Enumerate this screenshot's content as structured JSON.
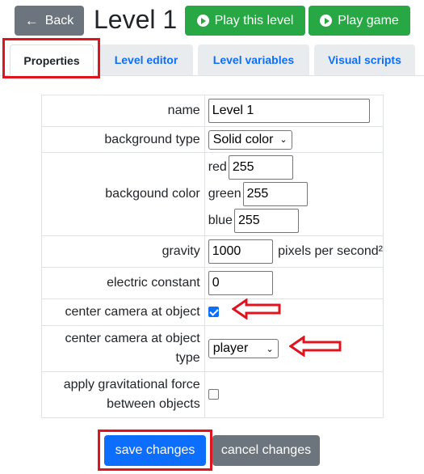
{
  "header": {
    "back_label": "Back",
    "back_icon": "arrow-left-icon",
    "title": "Level 1",
    "play_level_label": "Play this level",
    "play_game_label": "Play game",
    "play_icon": "play-circle-icon"
  },
  "tabs": [
    {
      "label": "Properties",
      "active": true
    },
    {
      "label": "Level editor",
      "active": false
    },
    {
      "label": "Level variables",
      "active": false
    },
    {
      "label": "Visual scripts",
      "active": false
    }
  ],
  "form": {
    "name": {
      "label": "name",
      "value": "Level 1"
    },
    "background_type": {
      "label": "background type",
      "value": "Solid color"
    },
    "background_color": {
      "label": "backgound color",
      "red_label": "red",
      "red_value": "255",
      "green_label": "green",
      "green_value": "255",
      "blue_label": "blue",
      "blue_value": "255"
    },
    "gravity": {
      "label": "gravity",
      "value": "1000",
      "unit": "pixels per second²"
    },
    "electric_constant": {
      "label": "electric constant",
      "value": "0"
    },
    "center_camera": {
      "label": "center camera at object",
      "checked": true
    },
    "center_camera_type": {
      "label": "center camera at object type",
      "value": "player"
    },
    "gravitational_force": {
      "label": "apply gravitational force between objects",
      "checked": false
    }
  },
  "actions": {
    "save_label": "save changes",
    "cancel_label": "cancel changes"
  },
  "colors": {
    "primary": "#0d6efd",
    "success": "#28a745",
    "secondary": "#6c757d",
    "annotation_red": "#e0141e"
  }
}
